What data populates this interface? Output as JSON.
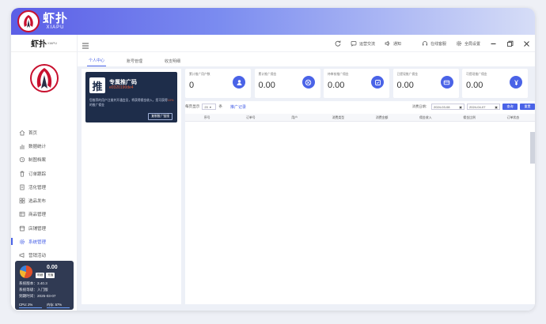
{
  "brand": {
    "cn": "虾扑",
    "en": "XIAPU"
  },
  "header": {
    "items": [
      {
        "label": "运营交流",
        "icon": "chat-icon"
      },
      {
        "label": "通知",
        "icon": "speaker-icon"
      },
      {
        "label": "在线客服",
        "icon": "headset-icon"
      },
      {
        "label": "全局设置",
        "icon": "gear-icon"
      }
    ]
  },
  "tabs": [
    {
      "label": "个人中心",
      "active": true
    },
    {
      "label": "账号管理",
      "active": false
    },
    {
      "label": "收支明细",
      "active": false
    }
  ],
  "nav": [
    {
      "label": "首页",
      "icon": "home-icon"
    },
    {
      "label": "数据统计",
      "icon": "chart-icon"
    },
    {
      "label": "制图档案",
      "icon": "clock-icon"
    },
    {
      "label": "订单跟踪",
      "icon": "trash-icon"
    },
    {
      "label": "活化管理",
      "icon": "doc-icon"
    },
    {
      "label": "选品发布",
      "icon": "grid-icon"
    },
    {
      "label": "商品管理",
      "icon": "table-icon"
    },
    {
      "label": "店铺管理",
      "icon": "store-icon"
    },
    {
      "label": "系统管理",
      "icon": "gear-icon",
      "active": true
    },
    {
      "label": "营销活动",
      "icon": "megaphone-icon"
    }
  ],
  "system": {
    "balance": "0.00",
    "buttons": [
      "明细",
      "充值"
    ],
    "version_label": "系统版本：",
    "version": "3.40.3",
    "level_label": "系统等级：",
    "level": "入门版",
    "expire_label": "到期时间：",
    "expire": "2025-03-07",
    "cpu": "CPU: 2%",
    "mem": "内存: 57%"
  },
  "promo": {
    "badge": "推",
    "title": "专属推广码",
    "code": "e0320190de4",
    "desc_a": "您推荐的用户注册并开通会员，将获得佣金收入，您",
    "desc_b": "可获得",
    "desc_hl": "10%",
    "desc_c": "的推广佣金",
    "button": "复制推广链接"
  },
  "stats": [
    {
      "label": "累计推广用户数",
      "value": "0",
      "icon": "user-icon"
    },
    {
      "label": "累计推广佣金",
      "value": "0.00",
      "icon": "globe-icon"
    },
    {
      "label": "待审核推广佣金",
      "value": "0.00",
      "icon": "check-icon"
    },
    {
      "label": "已提现推广佣金",
      "value": "0.00",
      "icon": "card-icon"
    },
    {
      "label": "可提现推广佣金",
      "value": "0.00",
      "icon": "yen-icon"
    }
  ],
  "filter": {
    "per_page_label": "每页显示",
    "per_page": "20",
    "unit": "条",
    "link": "推广记录",
    "date_label": "消费日期：",
    "date_from": "2024-03-08",
    "date_to": "2024-04-07",
    "search": "查询",
    "reset": "重置"
  },
  "table": {
    "headers": [
      "序号",
      "订单号",
      "用户",
      "消费类型",
      "消费金额",
      "佣金收入",
      "佣金比例",
      "订单状态"
    ]
  }
}
